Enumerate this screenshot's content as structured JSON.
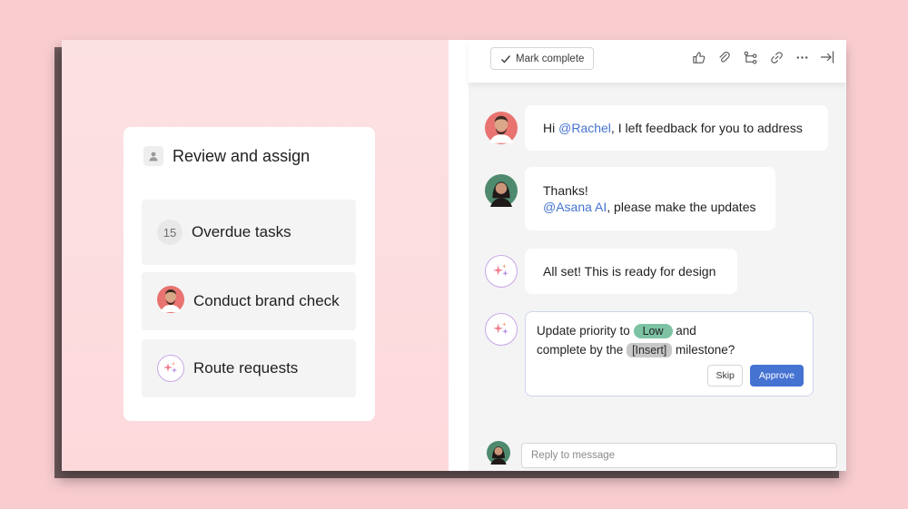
{
  "card": {
    "title": "Review and assign",
    "rows": [
      {
        "badge": "15",
        "label": "Overdue tasks"
      },
      {
        "label": "Conduct brand check"
      },
      {
        "label": "Route requests"
      }
    ]
  },
  "toolbar": {
    "mark_complete_label": "Mark complete",
    "icons": [
      "thumbs-up-icon",
      "paperclip-icon",
      "subtasks-icon",
      "link-icon",
      "more-icon",
      "close-pane-icon"
    ]
  },
  "messages": [
    {
      "text_before": "Hi ",
      "mention": "@Rachel",
      "text_after": ", I left feedback for you to address"
    },
    {
      "line1": "Thanks!",
      "mention": "@Asana AI",
      "text_after": ", please make the updates"
    },
    {
      "text": "All set! This is ready for design"
    },
    {
      "part1": "Update priority to ",
      "tag_low": "Low",
      "part2": " and",
      "part3": "complete by the ",
      "tag_insert": "[Insert]",
      "part4": " milestone?",
      "skip_label": "Skip",
      "approve_label": "Approve"
    }
  ],
  "reply": {
    "placeholder": "Reply to message"
  },
  "colors": {
    "accent": "#4573d2",
    "tag_low": "#7dc3a3",
    "background": "#f9cdd0"
  }
}
